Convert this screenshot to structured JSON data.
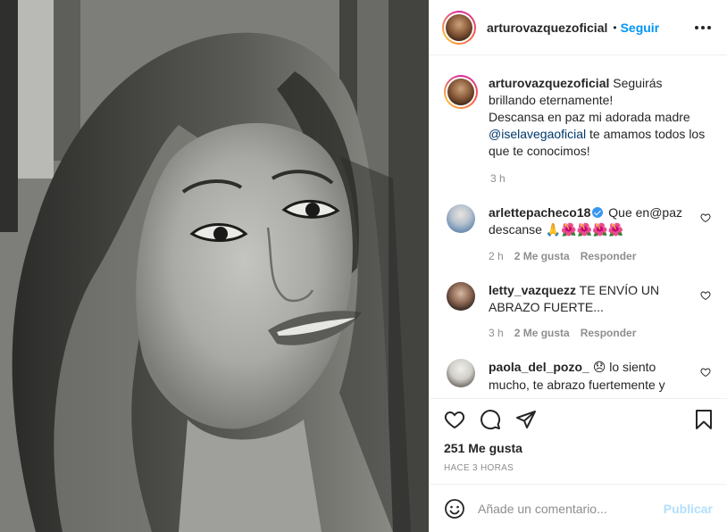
{
  "post": {
    "author": "arturovazquezoficial",
    "follow_label": "Seguir",
    "separator": "•",
    "more_icon": "more-horizontal-icon"
  },
  "caption": {
    "author": "arturovazquezoficial",
    "text_1": " Seguirás brillando eternamente!",
    "text_2": "Descansa en paz mi adorada madre",
    "mention": "@iselavegaoficial",
    "text_3": " te amamos todos los que te conocimos!",
    "time": "3 h"
  },
  "comments": [
    {
      "user": "arlettepacheco18",
      "verified": true,
      "text": " Que en@paz descanse ",
      "emojis": "🙏🌺🌺🌺🌺",
      "time": "2 h",
      "likes": "2 Me gusta",
      "reply": "Responder"
    },
    {
      "user": "letty_vazquezz",
      "text": " TE ENVÍO UN ABRAZO FUERTE...",
      "time": "3 h",
      "likes": "2 Me gusta",
      "reply": "Responder"
    },
    {
      "user": "paola_del_pozo_",
      "text": " lo siento mucho, te abrazo fuertemente y",
      "emoji": "😞"
    }
  ],
  "actions": {
    "like_icon": "heart-icon",
    "comment_icon": "comment-icon",
    "share_icon": "share-icon",
    "save_icon": "bookmark-icon"
  },
  "likes": "251 Me gusta",
  "time_ago": "HACE 3 HORAS",
  "add_comment": {
    "emoji_icon": "smiley-icon",
    "placeholder": "Añade un comentario...",
    "publish_label": "Publicar"
  },
  "colors": {
    "accent": "#0095f6",
    "publish_disabled": "#b2dffc",
    "muted": "#8e8e8e",
    "border": "#efefef"
  }
}
